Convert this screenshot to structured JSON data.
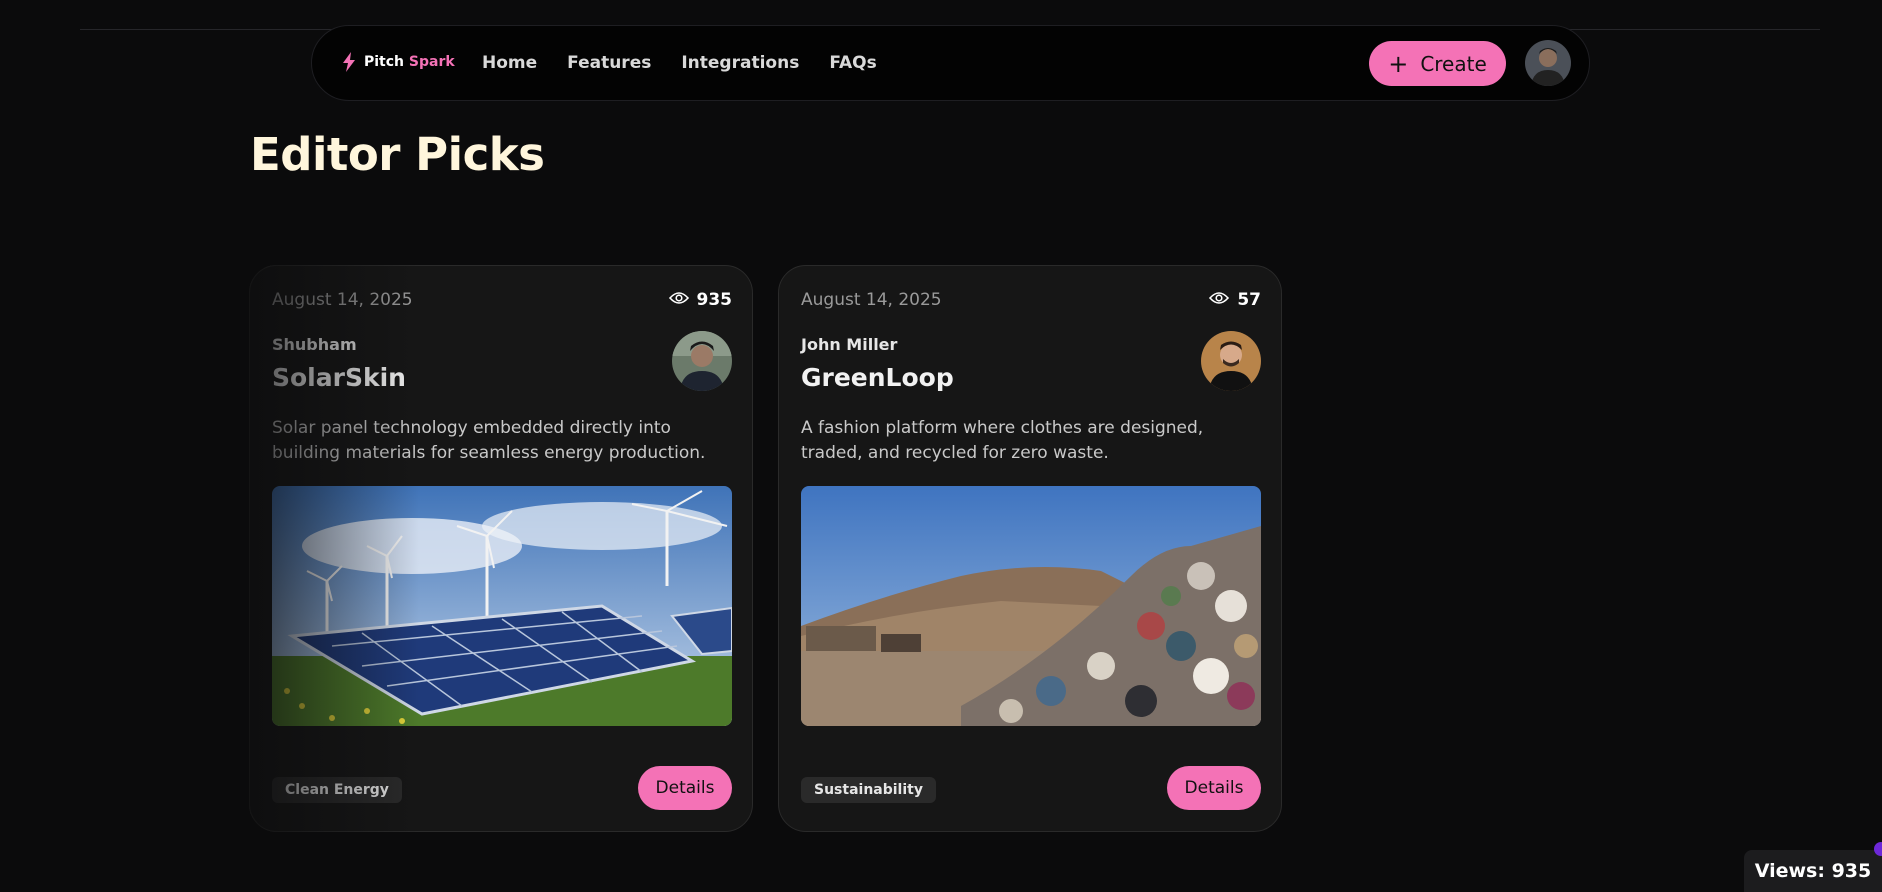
{
  "brand": {
    "name_part1": "Pitch",
    "name_part2": "Spark",
    "accent": "#f472b6"
  },
  "nav": {
    "links": [
      "Home",
      "Features",
      "Integrations",
      "FAQs"
    ],
    "create_label": "Create"
  },
  "page": {
    "title": "Editor Picks"
  },
  "cards": [
    {
      "date": "August 14, 2025",
      "views": "935",
      "author": "Shubham",
      "title": "SolarSkin",
      "description": "Solar panel technology embedded directly into building materials for seamless energy production.",
      "tag": "Clean Energy",
      "button": "Details"
    },
    {
      "date": "August 14, 2025",
      "views": "57",
      "author": "John Miller",
      "title": "GreenLoop",
      "description": "A fashion platform where clothes are designed, traded, and recycled for zero waste.",
      "tag": "Sustainability",
      "button": "Details"
    }
  ],
  "views_widget": "Views: 935"
}
